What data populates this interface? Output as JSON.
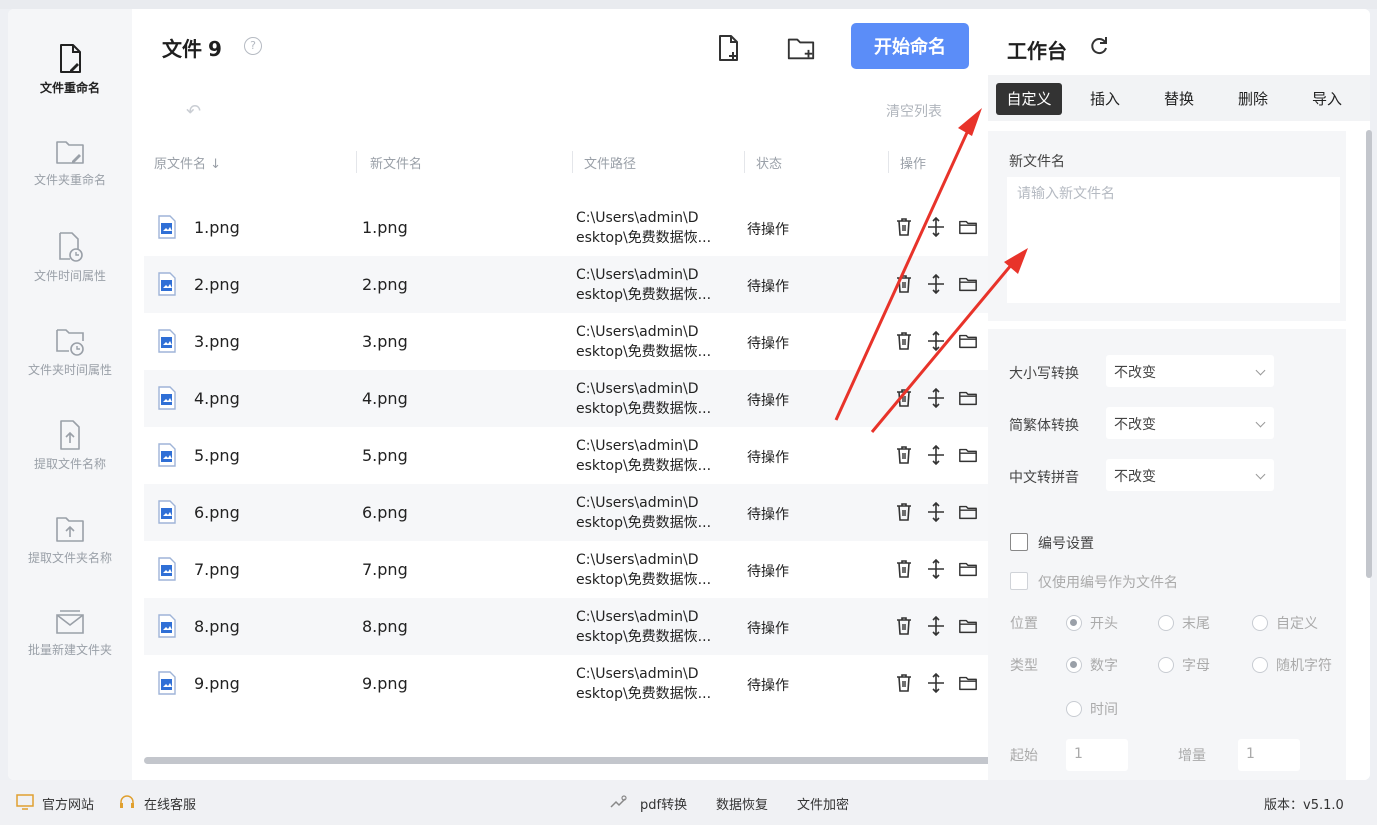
{
  "sidebar": {
    "items": [
      {
        "label": "文件重命名",
        "icon": "file-edit-icon",
        "active": true
      },
      {
        "label": "文件夹重命名",
        "icon": "folder-edit-icon"
      },
      {
        "label": "文件时间属性",
        "icon": "file-clock-icon"
      },
      {
        "label": "文件夹时间属性",
        "icon": "folder-clock-icon"
      },
      {
        "label": "提取文件名称",
        "icon": "file-extract-icon"
      },
      {
        "label": "提取文件夹名称",
        "icon": "folder-extract-icon"
      },
      {
        "label": "批量新建文件夹",
        "icon": "envelope-icon"
      }
    ]
  },
  "header": {
    "title": "文件",
    "count": "9",
    "help_icon": "?",
    "start_label": "开始命名",
    "clear_label": "清空列表",
    "undo_icon": "↶"
  },
  "table": {
    "columns": [
      "原文件名 ↓",
      "新文件名",
      "文件路径",
      "状态",
      "操作"
    ],
    "rows": [
      {
        "name": "1.png",
        "new_name": "1.png",
        "path1": "C:\\Users\\admin\\D",
        "path2": "esktop\\免费数据恢...",
        "status": "待操作"
      },
      {
        "name": "2.png",
        "new_name": "2.png",
        "path1": "C:\\Users\\admin\\D",
        "path2": "esktop\\免费数据恢...",
        "status": "待操作"
      },
      {
        "name": "3.png",
        "new_name": "3.png",
        "path1": "C:\\Users\\admin\\D",
        "path2": "esktop\\免费数据恢...",
        "status": "待操作"
      },
      {
        "name": "4.png",
        "new_name": "4.png",
        "path1": "C:\\Users\\admin\\D",
        "path2": "esktop\\免费数据恢...",
        "status": "待操作"
      },
      {
        "name": "5.png",
        "new_name": "5.png",
        "path1": "C:\\Users\\admin\\D",
        "path2": "esktop\\免费数据恢...",
        "status": "待操作"
      },
      {
        "name": "6.png",
        "new_name": "6.png",
        "path1": "C:\\Users\\admin\\D",
        "path2": "esktop\\免费数据恢...",
        "status": "待操作"
      },
      {
        "name": "7.png",
        "new_name": "7.png",
        "path1": "C:\\Users\\admin\\D",
        "path2": "esktop\\免费数据恢...",
        "status": "待操作"
      },
      {
        "name": "8.png",
        "new_name": "8.png",
        "path1": "C:\\Users\\admin\\D",
        "path2": "esktop\\免费数据恢...",
        "status": "待操作"
      },
      {
        "name": "9.png",
        "new_name": "9.png",
        "path1": "C:\\Users\\admin\\D",
        "path2": "esktop\\免费数据恢...",
        "status": "待操作"
      }
    ]
  },
  "panel": {
    "title": "工作台",
    "tabs": [
      "自定义",
      "插入",
      "替换",
      "删除",
      "导入"
    ],
    "active_tab": "自定义",
    "new_name_label": "新文件名",
    "new_name_placeholder": "请输入新文件名",
    "new_name_value": "",
    "case_label": "大小写转换",
    "case_value": "不改变",
    "trad_label": "简繁体转换",
    "trad_value": "不改变",
    "pinyin_label": "中文转拼音",
    "pinyin_value": "不改变",
    "numbering_label": "编号设置",
    "numbering_checked": false,
    "only_number_label": "仅使用编号作为文件名",
    "only_number_checked": false,
    "position_label": "位置",
    "position_options": [
      "开头",
      "末尾",
      "自定义"
    ],
    "position_selected": "开头",
    "type_label": "类型",
    "type_options": [
      "数字",
      "字母",
      "随机字符",
      "时间"
    ],
    "type_selected": "数字",
    "start_label": "起始",
    "start_value": "1",
    "step_label": "增量",
    "step_value": "1"
  },
  "footer": {
    "website": "官方网站",
    "support": "在线客服",
    "pdf": "pdf转换",
    "recovery": "数据恢复",
    "encrypt": "文件加密",
    "version_label": "版本：",
    "version": "v5.1.0"
  },
  "colors": {
    "accent": "#5b8df8",
    "active_tab": "#333333",
    "annotation_arrow": "#e8332a",
    "row_alt": "#f6f7f9"
  }
}
